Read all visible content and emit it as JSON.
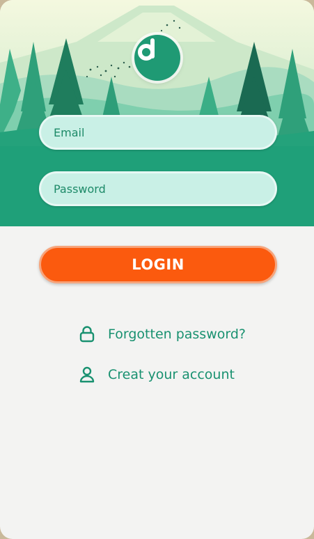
{
  "form": {
    "email_placeholder": "Email",
    "password_placeholder": "Password",
    "login_label": "LOGIN"
  },
  "links": {
    "forgot_label": "Forgotten password?",
    "forgot_icon": "lock-icon",
    "create_label": "Creat your account",
    "create_icon": "user-icon"
  },
  "colors": {
    "brand_green": "#1f9a74",
    "accent_orange": "#fb5a0e",
    "field_fill": "#c9f0e6",
    "link_text": "#199170"
  }
}
